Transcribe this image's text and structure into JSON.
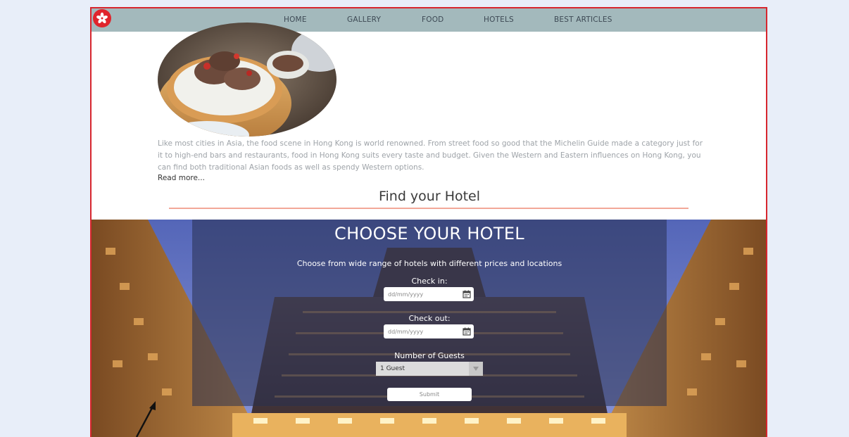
{
  "nav": {
    "items": [
      {
        "label": "HOME"
      },
      {
        "label": "GALLERY"
      },
      {
        "label": "FOOD"
      },
      {
        "label": "HOTELS"
      },
      {
        "label": "BEST ARTICLES"
      }
    ]
  },
  "food": {
    "description": "Like most cities in Asia, the food scene in Hong Kong is world renowned. From street food so good that the Michelin Guide made a category just for it to high-end bars and restaurants, food in Hong Kong suits every taste and budget. Given the Western and Eastern influences on Hong Kong, you can find both traditional Asian foods as well as spendy Western options.",
    "read_more": "Read more..."
  },
  "hotel_section": {
    "heading": "Find your Hotel",
    "panel_title": "CHOOSE YOUR HOTEL",
    "subtitle": "Choose from wide range of hotels with different prices and locations",
    "check_in_label": "Check in:",
    "check_in_placeholder": "dd/mm/yyyy",
    "check_out_label": "Check out:",
    "check_out_placeholder": "dd/mm/yyyy",
    "guests_label": "Number of Guests",
    "guests_value": "1 Guest",
    "submit_label": "Submit"
  },
  "colors": {
    "accent": "#d7262e",
    "navbar": "#a3b9bc",
    "rule": "#f2a898"
  }
}
